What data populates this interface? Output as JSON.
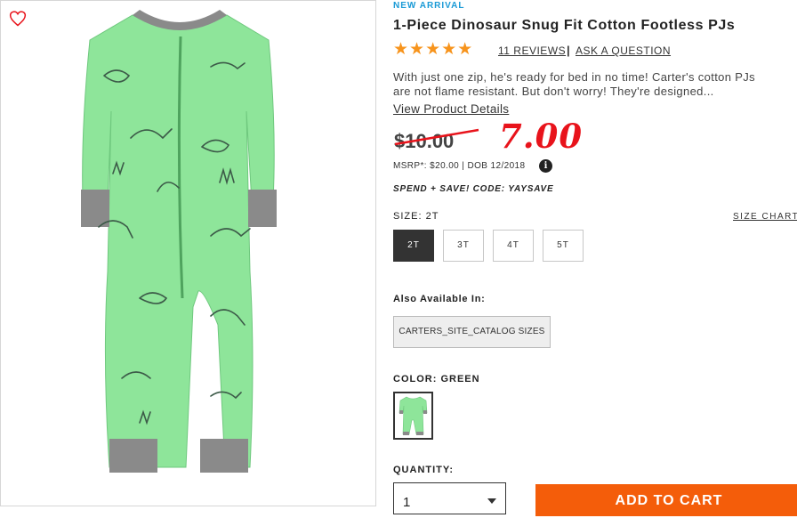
{
  "product": {
    "badge": "NEW ARRIVAL",
    "title": "1-Piece Dinosaur Snug Fit Cotton Footless PJs",
    "rating": {
      "stars": "★★★★★",
      "value": 5,
      "max": 5
    },
    "reviews_link": "11 REVIEWS",
    "separator": "|",
    "ask_link": "ASK A QUESTION",
    "description": "With just one zip, he's ready for bed in no time! Carter's cotton PJs are not flame resistant. But don't worry! They're designed...",
    "details_link": "View Product Details"
  },
  "price": {
    "original": "$10.00",
    "annotated": "7.00",
    "msrp_line": "MSRP*: $20.00 | DOB 12/2018",
    "info_icon": "i",
    "promo": "SPEND + SAVE! CODE: YAYSAVE"
  },
  "size": {
    "label": "SIZE:",
    "selected": "2T",
    "chart_link": "SIZE CHART",
    "options": [
      "2T",
      "3T",
      "4T",
      "5T"
    ]
  },
  "also_available": {
    "label": "Also Available In:",
    "option": "CARTERS_SITE_CATALOG SIZES"
  },
  "color": {
    "label": "COLOR:",
    "selected": "GREEN"
  },
  "quantity": {
    "label": "QUANTITY:",
    "value": "1"
  },
  "cart": {
    "label": "ADD TO CART"
  },
  "icons": {
    "favorite": "heart-icon",
    "info": "info-icon",
    "dropdown": "chevron-down-icon"
  },
  "colors": {
    "accent": "#1a9ad6",
    "stars": "#f7941d",
    "cart": "#f45d0a",
    "annotation": "#e8131b",
    "product": "#8ee59a"
  }
}
